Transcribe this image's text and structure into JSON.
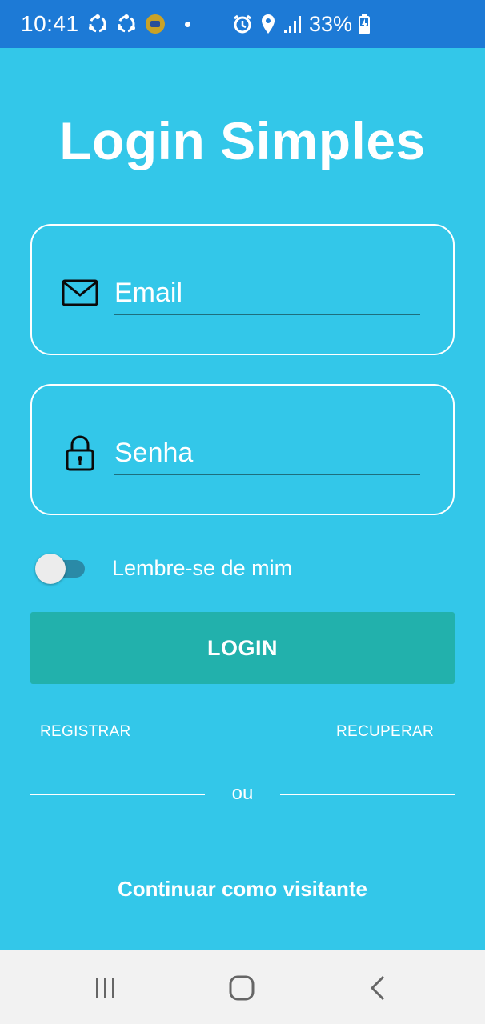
{
  "status_bar": {
    "time": "10:41",
    "battery": "33%",
    "left_icons": [
      "sync-icon",
      "sync-icon",
      "app-notification-icon",
      "dot-icon"
    ],
    "right_icons": [
      "alarm-icon",
      "location-icon",
      "signal-icon",
      "battery-charging-icon"
    ]
  },
  "title": "Login Simples",
  "email_field": {
    "placeholder": "Email",
    "value": "",
    "icon": "mail-icon"
  },
  "password_field": {
    "placeholder": "Senha",
    "value": "",
    "icon": "lock-icon"
  },
  "remember_me": {
    "label": "Lembre-se de mim",
    "checked": false
  },
  "login_button": {
    "label": "LOGIN"
  },
  "links": {
    "register": "REGISTRAR",
    "recover": "RECUPERAR"
  },
  "divider": {
    "text": "ou"
  },
  "guest_link": "Continuar como visitante",
  "nav_bar": {
    "buttons": [
      "recents-icon",
      "home-icon",
      "back-icon"
    ]
  },
  "colors": {
    "background": "#33c7e9",
    "status_bar": "#1d7ad6",
    "button": "#22b1ac",
    "nav_bar": "#f2f2f2"
  }
}
